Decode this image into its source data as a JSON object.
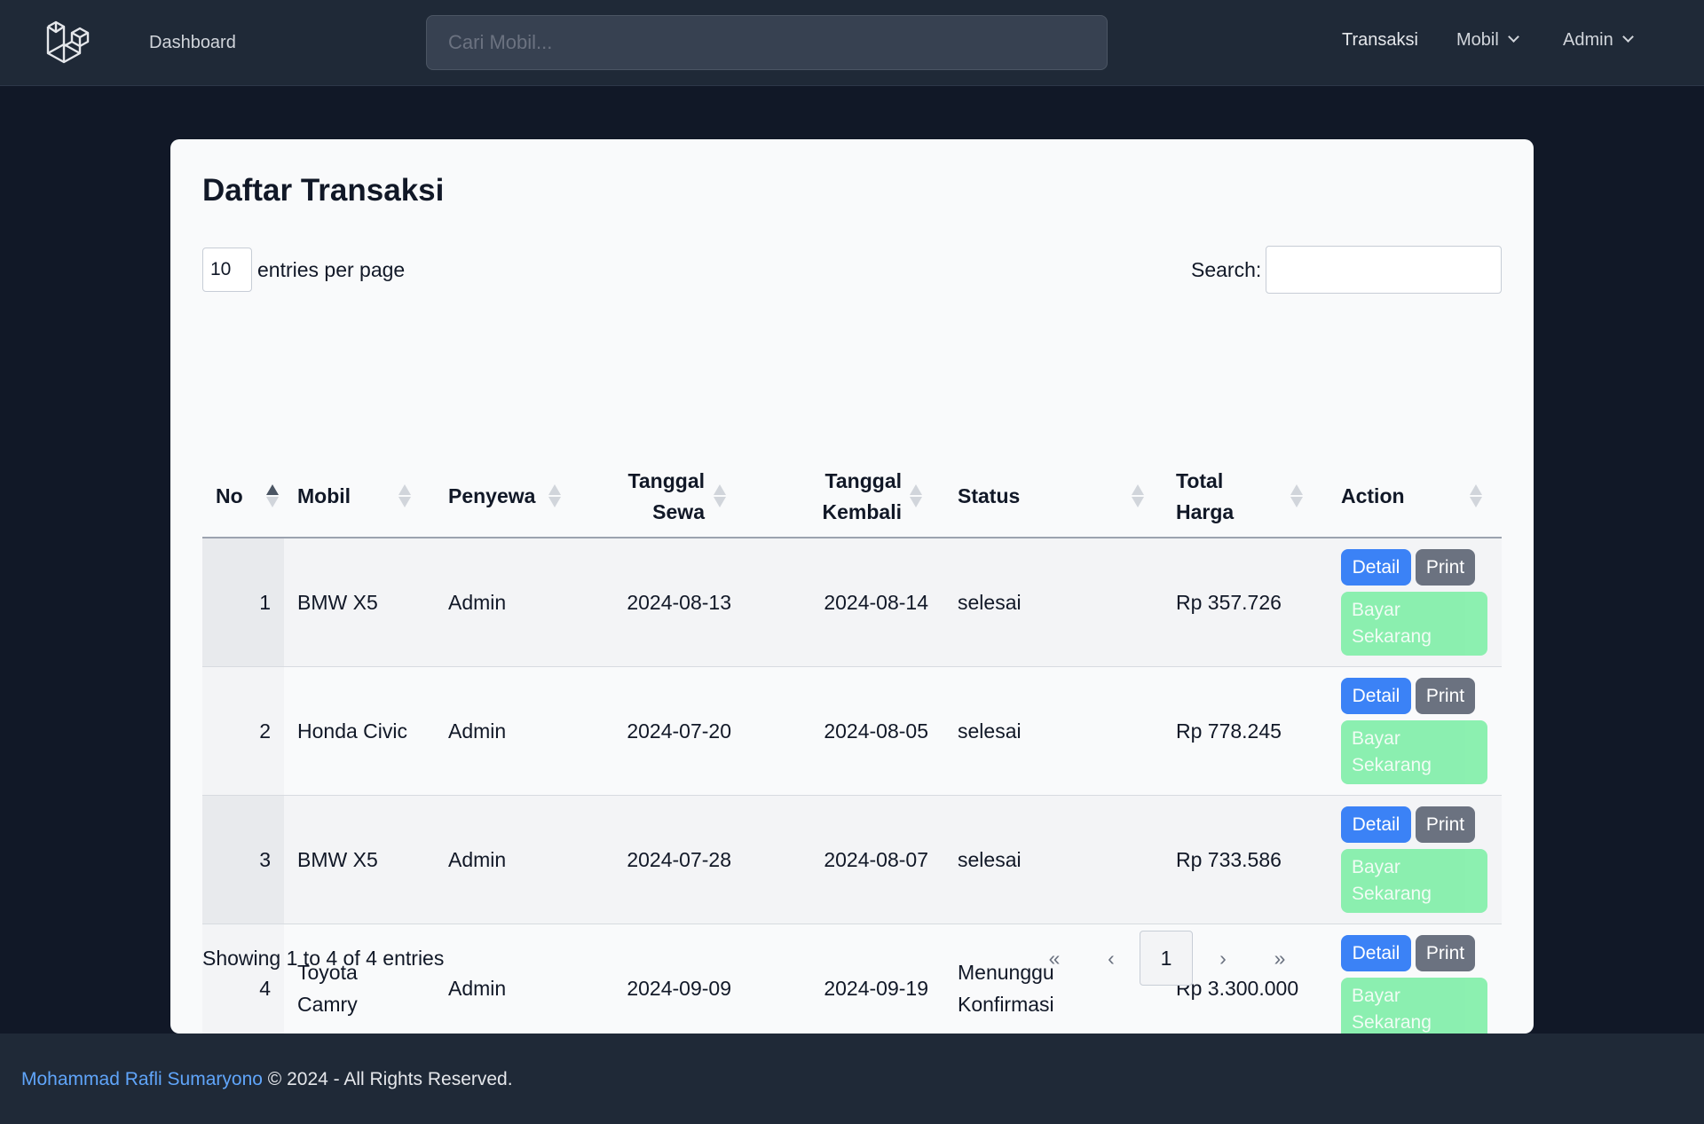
{
  "navbar": {
    "logo_icon": "laravel-logo-icon",
    "dashboard_label": "Dashboard",
    "search_placeholder": "Cari Mobil...",
    "transaksi_label": "Transaksi",
    "mobil_label": "Mobil",
    "admin_label": "Admin"
  },
  "page": {
    "title": "Daftar Transaksi",
    "entries_value": "10",
    "entries_label": "entries per page",
    "search_label": "Search:"
  },
  "table": {
    "headers": {
      "no": "No",
      "mobil": "Mobil",
      "penyewa": "Penyewa",
      "tanggal_sewa": [
        "Tanggal",
        "Sewa"
      ],
      "tanggal_kembali": [
        "Tanggal",
        "Kembali"
      ],
      "status": "Status",
      "total_harga": [
        "Total",
        "Harga"
      ],
      "action": "Action"
    },
    "rows": [
      {
        "no": "1",
        "mobil": [
          "BMW X5"
        ],
        "penyewa": "Admin",
        "tanggal_sewa": "2024-08-13",
        "tanggal_kembali": "2024-08-14",
        "status": [
          "selesai"
        ],
        "total_harga": "Rp 357.726"
      },
      {
        "no": "2",
        "mobil": [
          "Honda Civic"
        ],
        "penyewa": "Admin",
        "tanggal_sewa": "2024-07-20",
        "tanggal_kembali": "2024-08-05",
        "status": [
          "selesai"
        ],
        "total_harga": "Rp 778.245"
      },
      {
        "no": "3",
        "mobil": [
          "BMW X5"
        ],
        "penyewa": "Admin",
        "tanggal_sewa": "2024-07-28",
        "tanggal_kembali": "2024-08-07",
        "status": [
          "selesai"
        ],
        "total_harga": "Rp 733.586"
      },
      {
        "no": "4",
        "mobil": [
          "Toyota",
          "Camry"
        ],
        "penyewa": "Admin",
        "tanggal_sewa": "2024-09-09",
        "tanggal_kembali": "2024-09-19",
        "status": [
          "Menunggu",
          "Konfirmasi"
        ],
        "total_harga": "Rp 3.300.000"
      }
    ],
    "actions": {
      "detail": "Detail",
      "print": "Print",
      "bayar": [
        "Bayar",
        "Sekarang"
      ]
    }
  },
  "footer_info": {
    "showing": "Showing 1 to 4 of 4 entries",
    "pager": {
      "first": "«",
      "prev": "‹",
      "current": "1",
      "next": "›",
      "last": "»"
    }
  },
  "footer": {
    "author": "Mohammad Rafli Sumaryono",
    "rights": "© 2024 - All Rights Reserved."
  },
  "colors": {
    "navbar_bg": "#1f2937",
    "page_bg": "#111827",
    "detail_button": "#3b82f6",
    "print_button": "#6b7280",
    "bayar_button": "#86efac",
    "link": "#60a5fa"
  }
}
